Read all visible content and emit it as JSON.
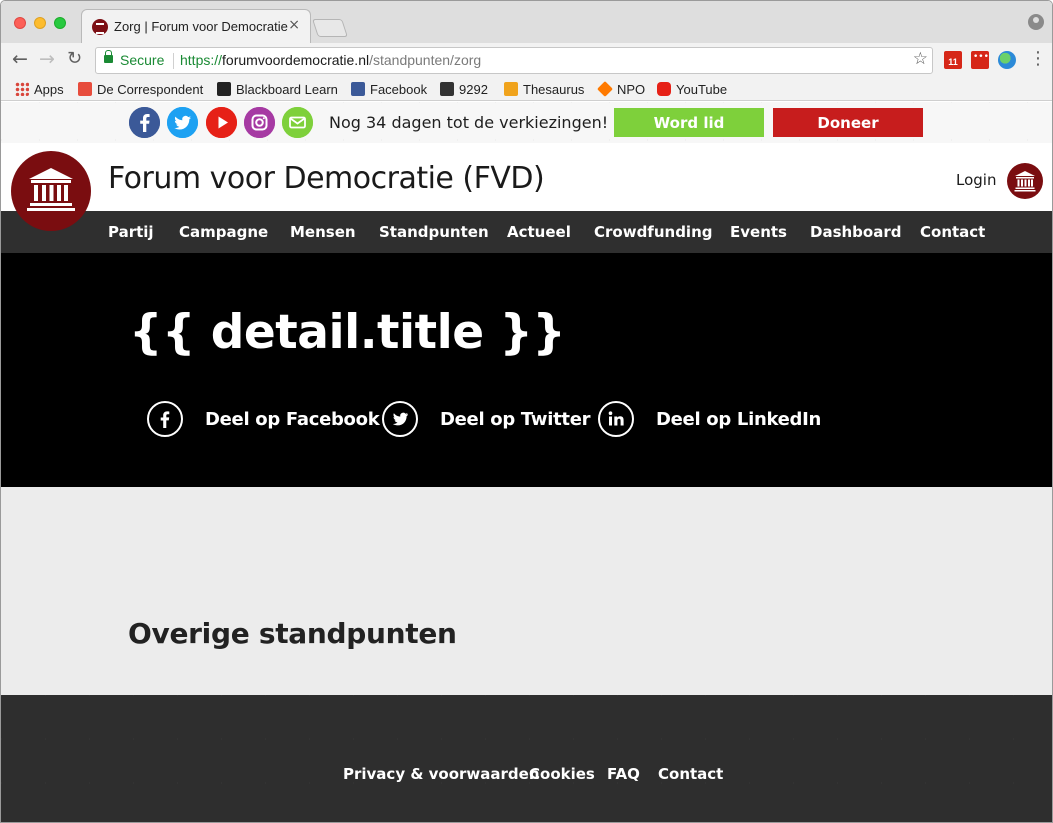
{
  "browser": {
    "tab_title": "Zorg | Forum voor Democratie",
    "tab_close": "×",
    "secure_label": "Secure",
    "url_scheme": "https://",
    "url_host": "forumvoordemocratie.nl",
    "url_path": "/standpunten/zorg",
    "calendar_badge": "11",
    "bookmarks": [
      {
        "label": "Apps",
        "icon": "apps-grid-icon"
      },
      {
        "label": "De Correspondent",
        "icon": "de-correspondent-icon"
      },
      {
        "label": "Blackboard Learn",
        "icon": "blackboard-icon"
      },
      {
        "label": "Facebook",
        "icon": "facebook-icon"
      },
      {
        "label": "9292",
        "icon": "9292-icon"
      },
      {
        "label": "Thesaurus",
        "icon": "thesaurus-icon"
      },
      {
        "label": "NPO",
        "icon": "npo-icon"
      },
      {
        "label": "YouTube",
        "icon": "youtube-icon"
      }
    ]
  },
  "topbar": {
    "social_icons": [
      "facebook-icon",
      "twitter-icon",
      "youtube-icon",
      "instagram-icon",
      "mail-icon"
    ],
    "countdown": "Nog 34 dagen tot de verkiezingen!",
    "join_button": "Word lid",
    "donate_button": "Doneer"
  },
  "header": {
    "site_title": "Forum voor Democratie (FVD)",
    "login": "Login"
  },
  "nav": {
    "items": [
      "Partij",
      "Campagne",
      "Mensen",
      "Standpunten",
      "Actueel",
      "Crowdfunding",
      "Events",
      "Dashboard",
      "Contact"
    ]
  },
  "hero": {
    "title": "{{ detail.title }}",
    "share": [
      {
        "label": "Deel op Facebook",
        "icon": "facebook-icon"
      },
      {
        "label": "Deel op Twitter",
        "icon": "twitter-icon"
      },
      {
        "label": "Deel op LinkedIn",
        "icon": "linkedin-icon"
      }
    ]
  },
  "content": {
    "section_title": "Overige standpunten"
  },
  "footer": {
    "links": [
      "Privacy & voorwaarden",
      "Cookies",
      "FAQ",
      "Contact"
    ]
  },
  "colors": {
    "brand_red": "#7a0d10",
    "join_green": "#7ed03b",
    "donate_red": "#c71d1d",
    "nav_bg": "#2f2f2f",
    "hero_bg": "#000000",
    "content_bg": "#ececec"
  }
}
